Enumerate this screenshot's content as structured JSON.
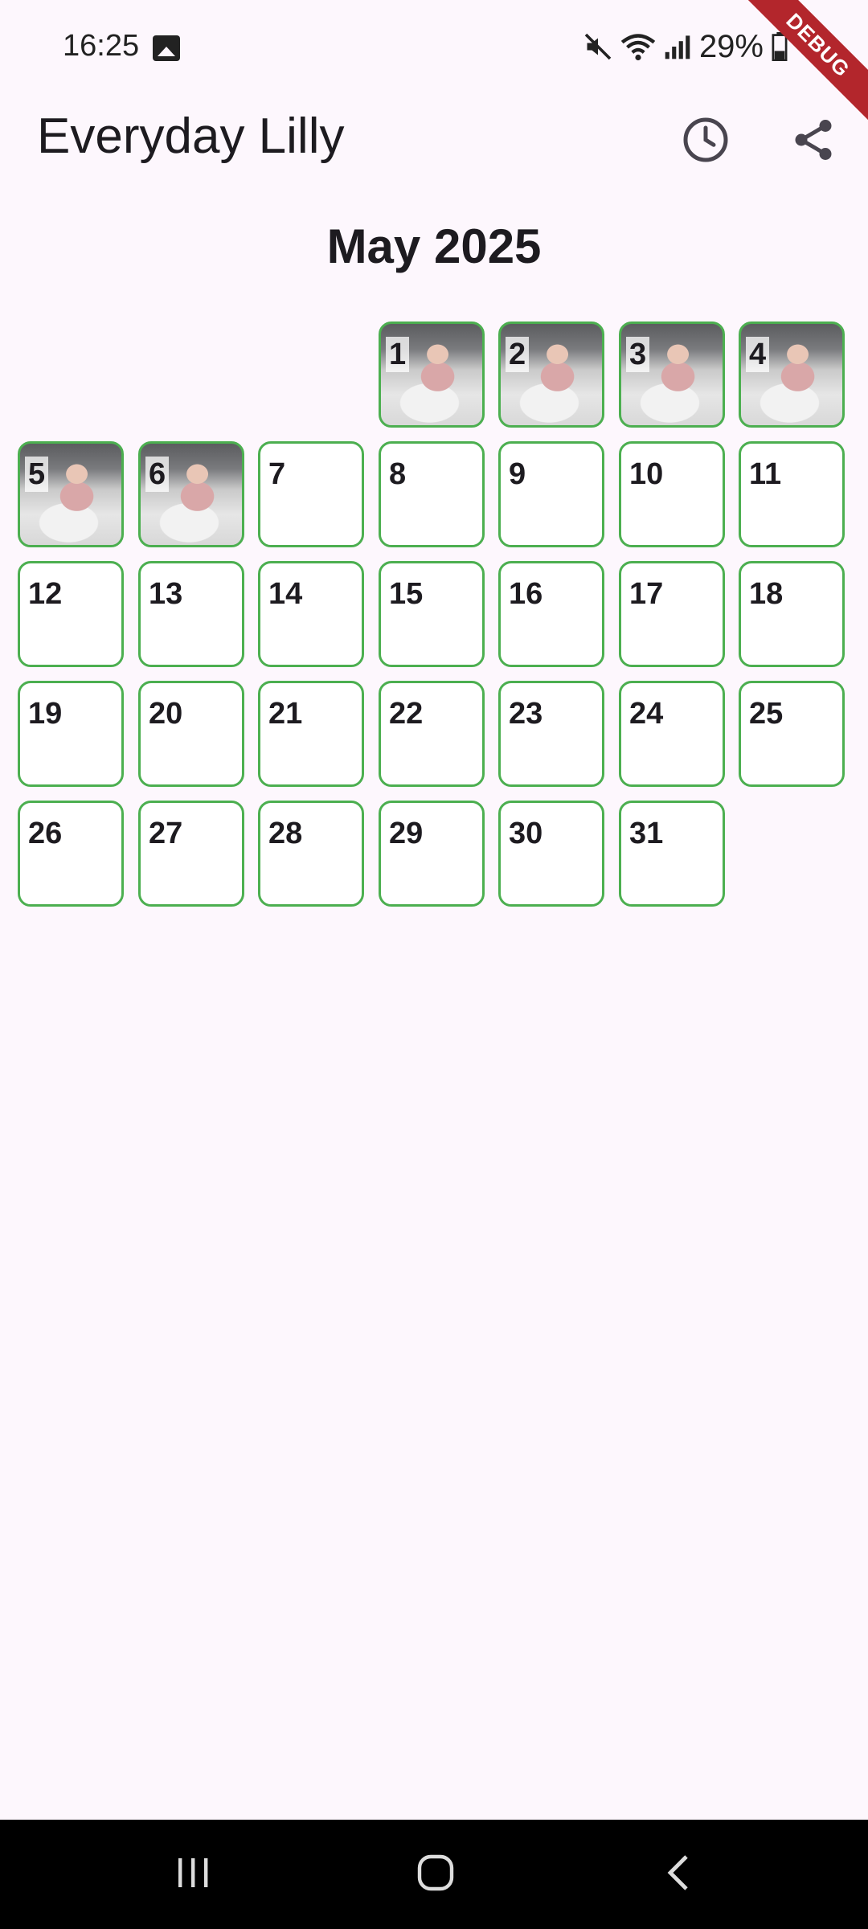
{
  "status_bar": {
    "time": "16:25",
    "battery": "29%",
    "icons": [
      "gallery-icon",
      "mute-icon",
      "wifi-icon",
      "signal-icon",
      "battery-icon"
    ]
  },
  "debug_banner": "DEBUG",
  "app_bar": {
    "title": "Everyday Lilly",
    "actions": [
      "history-icon",
      "share-icon"
    ]
  },
  "calendar": {
    "month_label": "May 2025",
    "border_color": "#4caf50",
    "days_with_photo": [
      "1",
      "2",
      "3",
      "4",
      "5",
      "6"
    ],
    "days": [
      "1",
      "2",
      "3",
      "4",
      "5",
      "6",
      "7",
      "8",
      "9",
      "10",
      "11",
      "12",
      "13",
      "14",
      "15",
      "16",
      "17",
      "18",
      "19",
      "20",
      "21",
      "22",
      "23",
      "24",
      "25",
      "26",
      "27",
      "28",
      "29",
      "30",
      "31"
    ]
  },
  "nav_bar": {
    "buttons": [
      "recents-icon",
      "home-icon",
      "back-icon"
    ]
  }
}
